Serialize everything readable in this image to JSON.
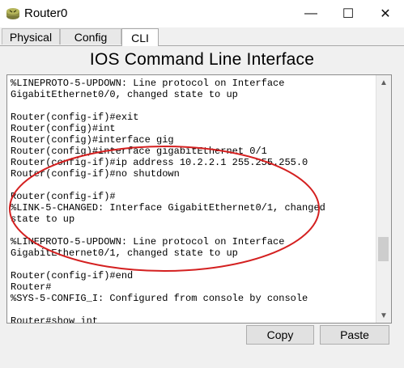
{
  "window": {
    "title": "Router0",
    "minimize_glyph": "—",
    "maximize_glyph": "☐",
    "close_glyph": "✕"
  },
  "tabs": [
    {
      "label": "Physical"
    },
    {
      "label": "Config"
    },
    {
      "label": "CLI",
      "active": true
    }
  ],
  "cli": {
    "heading": "IOS Command Line Interface",
    "lines": [
      "%LINEPROTO-5-UPDOWN: Line protocol on Interface",
      "GigabitEthernet0/0, changed state to up",
      "",
      "Router(config-if)#exit",
      "Router(config)#int",
      "Router(config)#interface gig",
      "Router(config)#interface gigabitEthernet 0/1",
      "Router(config-if)#ip address 10.2.2.1 255.255.255.0",
      "Router(config-if)#no shutdown",
      "",
      "Router(config-if)#",
      "%LINK-5-CHANGED: Interface GigabitEthernet0/1, changed",
      "state to up",
      "",
      "%LINEPROTO-5-UPDOWN: Line protocol on Interface",
      "GigabitEthernet0/1, changed state to up",
      "",
      "Router(config-if)#end",
      "Router#",
      "%SYS-5-CONFIG_I: Configured from console by console",
      "",
      "Router#show int"
    ]
  },
  "buttons": {
    "copy": "Copy",
    "paste": "Paste"
  },
  "colors": {
    "annotation_ellipse": "#d42020"
  },
  "icons": {
    "app": "router-icon",
    "scroll_up": "scroll-up-arrow-icon",
    "scroll_down": "scroll-down-arrow-icon"
  }
}
